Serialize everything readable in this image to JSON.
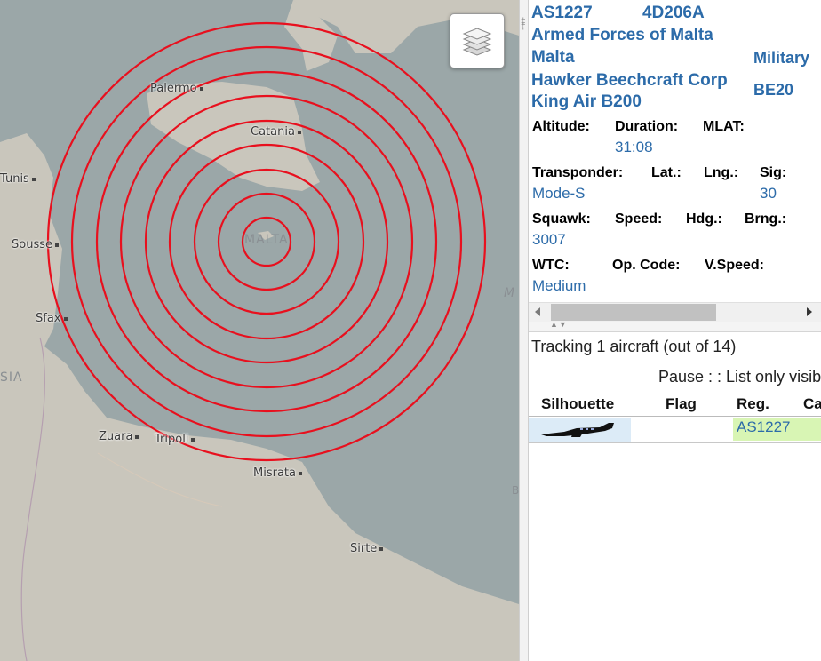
{
  "map": {
    "cities": [
      "Palermo",
      "Catania",
      "Tunis",
      "Sousse",
      "Sfax",
      "Zuara",
      "Tripoli",
      "Misrata",
      "Sirte"
    ],
    "regions": [
      "MALTA",
      "SIA",
      "M",
      "B"
    ],
    "range_ring_count": 10,
    "ring_color": "#e8101e",
    "layers_button": "layers-icon"
  },
  "aircraft": {
    "callsign": "AS1227",
    "icao": "4D206A",
    "operator": "Armed Forces of Malta",
    "country": "Malta",
    "category": "Military",
    "manufacturer": "Hawker Beechcraft Corp",
    "type_code": "BE20",
    "model": "King Air B200",
    "fields": {
      "altitude_label": "Altitude:",
      "duration_label": "Duration:",
      "duration_value": "31:08",
      "mlat_label": "MLAT:",
      "transponder_label": "Transponder:",
      "transponder_value": "Mode-S",
      "lat_label": "Lat.:",
      "lng_label": "Lng.:",
      "sig_label": "Sig:",
      "sig_value": "30",
      "squawk_label": "Squawk:",
      "squawk_value": "3007",
      "speed_label": "Speed:",
      "hdg_label": "Hdg.:",
      "brng_label": "Brng.:",
      "wtc_label": "WTC:",
      "wtc_value": "Medium",
      "opcode_label": "Op. Code:",
      "vspeed_label": "V.Speed:"
    }
  },
  "list": {
    "tracking_text": "Tracking 1 aircraft (out of 14)",
    "controls_text": "Pause : : List only visib",
    "columns": [
      "Silhouette",
      "Flag",
      "Reg.",
      "Ca"
    ],
    "rows": [
      {
        "reg": "AS1227",
        "silhouette_icon": "aircraft-silhouette-icon"
      }
    ]
  }
}
